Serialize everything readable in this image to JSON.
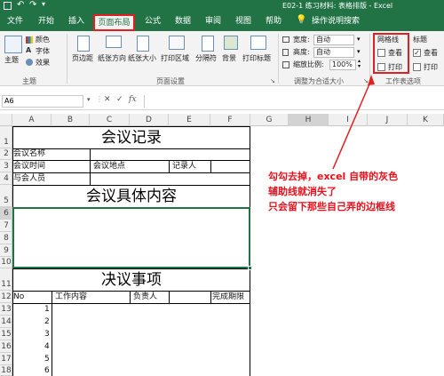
{
  "title_bar": {
    "title": "E02-1 练习材料: 表格排版 - Excel"
  },
  "tabs": [
    "文件",
    "开始",
    "插入",
    "页面布局",
    "公式",
    "数据",
    "审阅",
    "视图",
    "帮助",
    "操作说明搜索"
  ],
  "ribbon": {
    "theme": {
      "main": "主题",
      "colors": "颜色",
      "fonts": "字体",
      "effects": "效果",
      "group": "主题"
    },
    "page_setup": {
      "margins": "页边距",
      "orientation": "纸张方向",
      "size": "纸张大小",
      "print_area": "打印区域",
      "breaks": "分隔符",
      "background": "背景",
      "print_titles": "打印标题",
      "group": "页面设置"
    },
    "scale": {
      "width_label": "宽度:",
      "width_value": "自动",
      "height_label": "高度:",
      "height_value": "自动",
      "scale_label": "缩放比例:",
      "scale_value": "100%",
      "group": "调整为合适大小"
    },
    "gridlines": {
      "title": "网格线",
      "view": "查看",
      "print": "打印",
      "view_checked": false,
      "print_checked": false
    },
    "headings": {
      "title": "标题",
      "view": "查看",
      "print": "打印",
      "view_checked": true,
      "print_checked": false
    },
    "options_group": "工作表选项"
  },
  "formula_bar": {
    "name_box": "A6",
    "fx": "fx",
    "content": ""
  },
  "columns": [
    "A",
    "B",
    "C",
    "D",
    "E",
    "F",
    "G",
    "H",
    "I",
    "J",
    "K"
  ],
  "rows": [
    "1",
    "2",
    "3",
    "4",
    "5",
    "6",
    "7",
    "8",
    "9",
    "10",
    "11",
    "12",
    "13",
    "14",
    "15",
    "16",
    "17",
    "18"
  ],
  "sheet": {
    "title1": "会议记录",
    "meeting_name": "会议名称",
    "meeting_time": "会议时间",
    "meeting_place": "会议地点",
    "recorder": "记录人",
    "attendees": "与会人员",
    "title2": "会议具体内容",
    "title3": "决议事项",
    "col_no": "No",
    "col_work": "工作内容",
    "col_owner": "负责人",
    "col_deadline": "完成期限",
    "numbers": [
      "1",
      "2",
      "3",
      "4",
      "5",
      "6"
    ]
  },
  "annotation": {
    "line1": "勾勾去掉，excel 自带的灰色",
    "line2": "辅助线就消失了",
    "line3": "只会留下那些自己弄的边框线"
  },
  "colors": {
    "excel_green": "#217346",
    "highlight": "#e02020",
    "annotation": "#e8101c",
    "selection": "#217346"
  }
}
